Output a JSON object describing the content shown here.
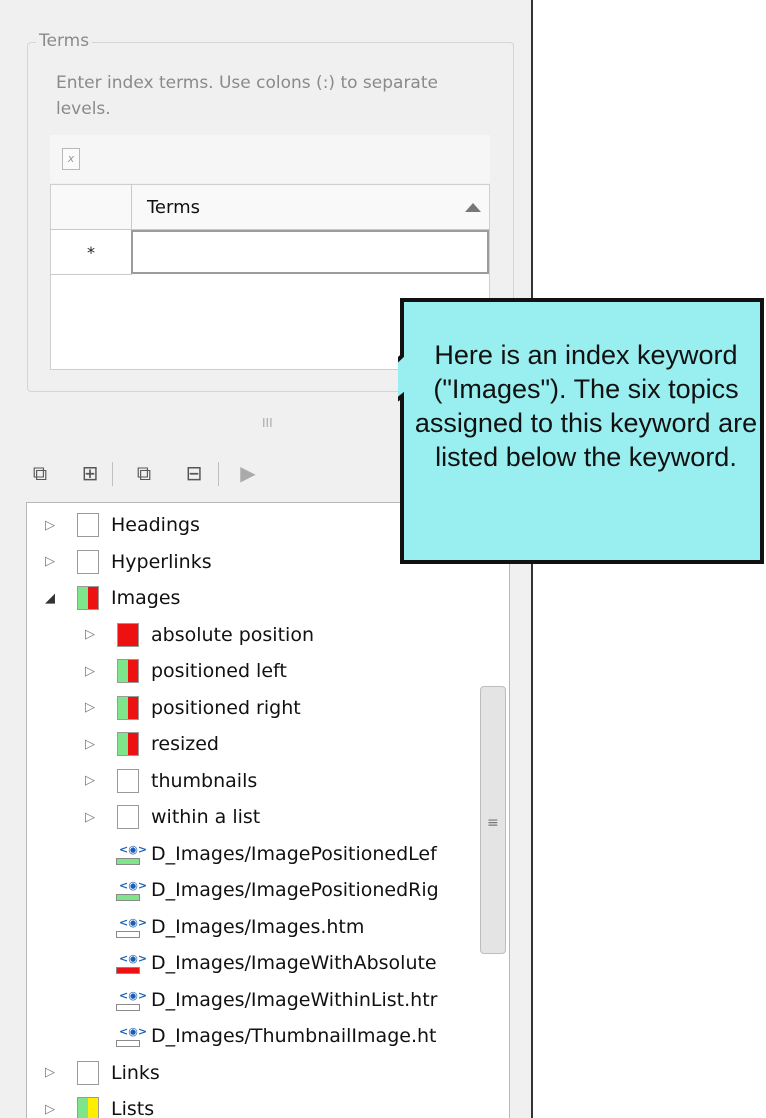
{
  "terms": {
    "group_label": "Terms",
    "hint": "Enter index terms. Use colons (:) to separate levels.",
    "column_header": "Terms",
    "new_row_marker": "*"
  },
  "tree": {
    "items": [
      {
        "label": "Headings",
        "level": 0,
        "expanded": false,
        "colors": []
      },
      {
        "label": "Hyperlinks",
        "level": 0,
        "expanded": false,
        "colors": []
      },
      {
        "label": "Images",
        "level": 0,
        "expanded": true,
        "colors": [
          "#7fe58a",
          "#ee1111"
        ]
      },
      {
        "label": "absolute position",
        "level": 1,
        "expanded": false,
        "colors": [
          "#ee1111"
        ]
      },
      {
        "label": "positioned left",
        "level": 1,
        "expanded": false,
        "colors": [
          "#7fe58a",
          "#ee1111"
        ]
      },
      {
        "label": "positioned right",
        "level": 1,
        "expanded": false,
        "colors": [
          "#7fe58a",
          "#ee1111"
        ]
      },
      {
        "label": "resized",
        "level": 1,
        "expanded": false,
        "colors": [
          "#7fe58a",
          "#ee1111"
        ]
      },
      {
        "label": "thumbnails",
        "level": 1,
        "expanded": false,
        "colors": []
      },
      {
        "label": "within a list",
        "level": 1,
        "expanded": false,
        "colors": []
      }
    ],
    "topics": [
      {
        "label": "D_Images/ImagePositionedLef",
        "bar_color": "#7fe58a"
      },
      {
        "label": "D_Images/ImagePositionedRig",
        "bar_color": "#7fe58a"
      },
      {
        "label": "D_Images/Images.htm",
        "bar_color": "#ffffff"
      },
      {
        "label": "D_Images/ImageWithAbsolute",
        "bar_color": "#ee1111"
      },
      {
        "label": "D_Images/ImageWithinList.htr",
        "bar_color": "#ffffff"
      },
      {
        "label": "D_Images/ThumbnailImage.ht",
        "bar_color": "#ffffff"
      }
    ],
    "after": [
      {
        "label": "Links",
        "level": 0,
        "expanded": false,
        "colors": []
      },
      {
        "label": "Lists",
        "level": 0,
        "expanded": false,
        "colors": [
          "#7fe58a",
          "#ffee00"
        ]
      }
    ]
  },
  "callout": {
    "text": "Here is an index keyword (\"Images\"). The six topics assigned to this keyword are listed below the keyword.",
    "fill": "#99eef0"
  }
}
